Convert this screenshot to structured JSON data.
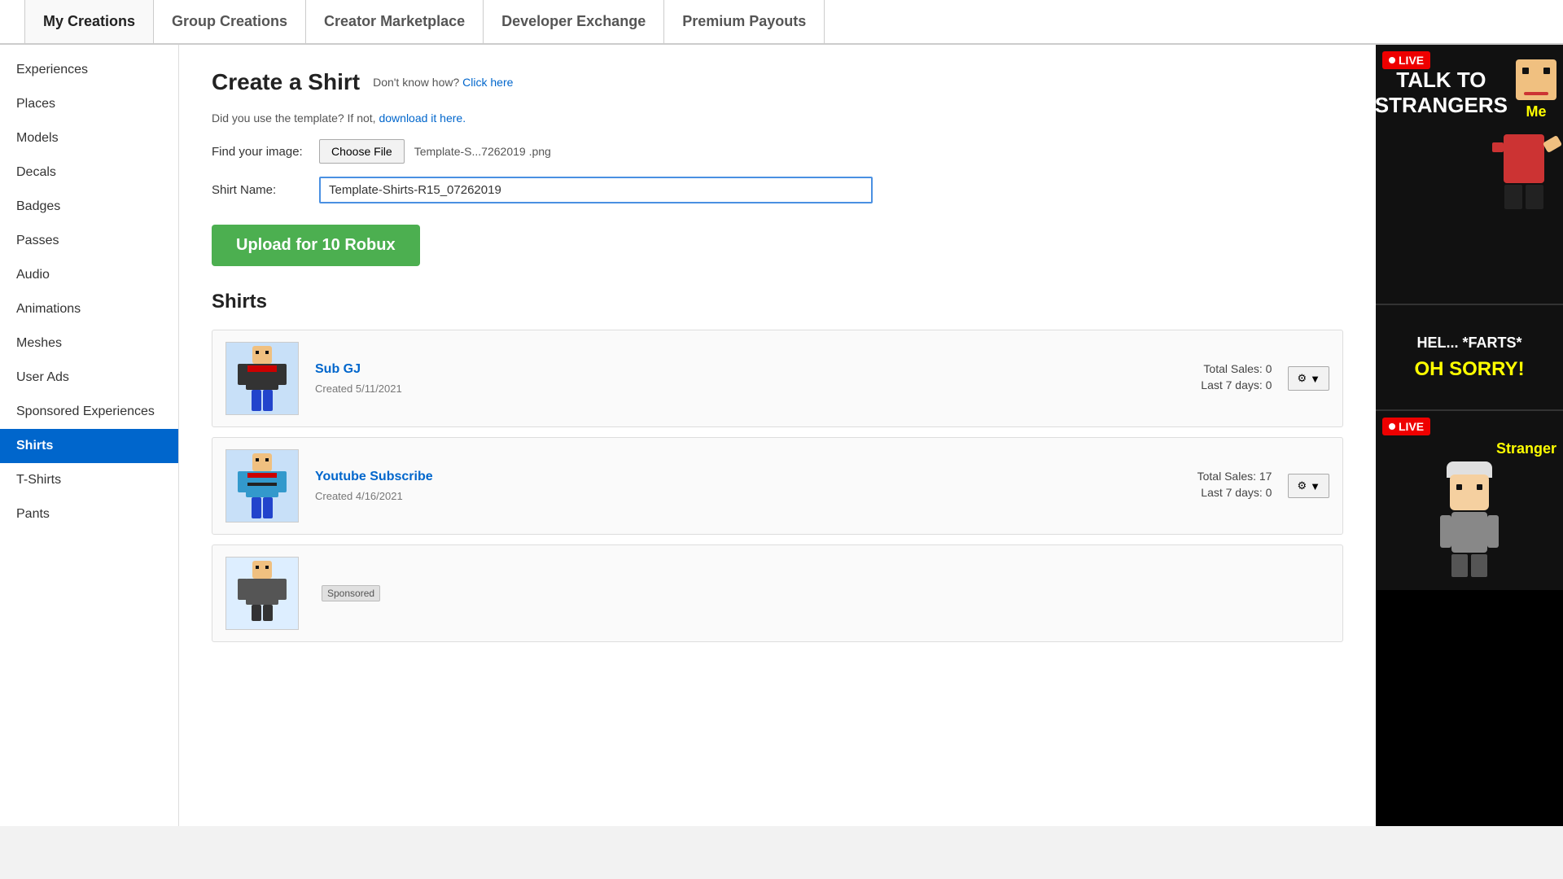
{
  "nav": {
    "tabs": [
      {
        "id": "my-creations",
        "label": "My Creations",
        "active": true
      },
      {
        "id": "group-creations",
        "label": "Group Creations",
        "active": false
      },
      {
        "id": "creator-marketplace",
        "label": "Creator Marketplace",
        "active": false
      },
      {
        "id": "developer-exchange",
        "label": "Developer Exchange",
        "active": false
      },
      {
        "id": "premium-payouts",
        "label": "Premium Payouts",
        "active": false
      }
    ]
  },
  "sidebar": {
    "items": [
      {
        "id": "experiences",
        "label": "Experiences",
        "active": false
      },
      {
        "id": "places",
        "label": "Places",
        "active": false
      },
      {
        "id": "models",
        "label": "Models",
        "active": false
      },
      {
        "id": "decals",
        "label": "Decals",
        "active": false
      },
      {
        "id": "badges",
        "label": "Badges",
        "active": false
      },
      {
        "id": "passes",
        "label": "Passes",
        "active": false
      },
      {
        "id": "audio",
        "label": "Audio",
        "active": false
      },
      {
        "id": "animations",
        "label": "Animations",
        "active": false
      },
      {
        "id": "meshes",
        "label": "Meshes",
        "active": false
      },
      {
        "id": "user-ads",
        "label": "User Ads",
        "active": false
      },
      {
        "id": "sponsored-experiences",
        "label": "Sponsored Experiences",
        "active": false
      },
      {
        "id": "shirts",
        "label": "Shirts",
        "active": true
      },
      {
        "id": "t-shirts",
        "label": "T-Shirts",
        "active": false
      },
      {
        "id": "pants",
        "label": "Pants",
        "active": false
      }
    ]
  },
  "create_shirt": {
    "title": "Create a Shirt",
    "help_text": "Don't know how?",
    "help_link_text": "Click here",
    "template_notice_prefix": "Did you use the template? If not,",
    "template_link_text": "download it here.",
    "find_image_label": "Find your image:",
    "choose_file_label": "Choose File",
    "file_name": "Template-S...7262019 .png",
    "shirt_name_label": "Shirt Name:",
    "shirt_name_value": "Template-Shirts-R15_07262019",
    "upload_button_label": "Upload for 10 Robux"
  },
  "shirts_section": {
    "title": "Shirts",
    "items": [
      {
        "id": "sub-gj",
        "name": "Sub GJ",
        "created": "Created  5/11/2021",
        "total_sales_label": "Total Sales:",
        "total_sales_value": "0",
        "last7_label": "Last 7 days:",
        "last7_value": "0",
        "sponsored": false
      },
      {
        "id": "youtube-subscribe",
        "name": "Youtube Subscribe",
        "created": "Created  4/16/2021",
        "total_sales_label": "Total Sales:",
        "total_sales_value": "17",
        "last7_label": "Last 7 days:",
        "last7_value": "0",
        "sponsored": false
      }
    ]
  },
  "ads": {
    "ad1": {
      "live": "LIVE",
      "title": "TALK TO\nSTRANGERS",
      "char_label": "Me"
    },
    "ad2": {
      "line1": "HEL... *FARTS*",
      "line2": "OH SORRY!"
    },
    "ad3": {
      "live": "LIVE",
      "char_label": "Stranger"
    }
  },
  "sponsored_label": "Sponsored"
}
